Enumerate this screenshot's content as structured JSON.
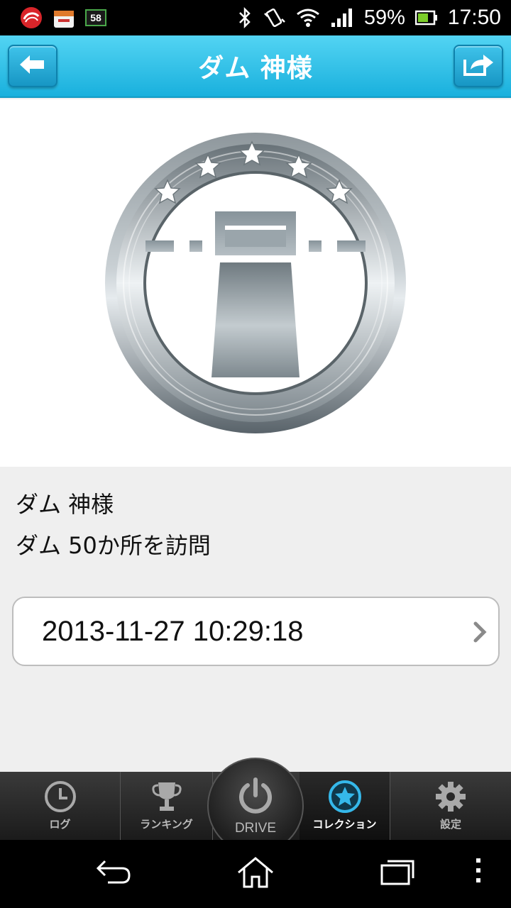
{
  "status_bar": {
    "notification_icons": [
      "trend-micro-icon",
      "market-icon",
      "counter-58-icon"
    ],
    "counter_badge": "58",
    "battery_percent": "59%",
    "time": "17:50"
  },
  "header": {
    "title": "ダム 神様",
    "back_icon": "back-arrow-icon",
    "share_icon": "share-icon"
  },
  "medal": {
    "stars": 5,
    "icon": "dam-medal-icon"
  },
  "info": {
    "title": "ダム 神様",
    "description": "ダム 50か所を訪問"
  },
  "history": {
    "items": [
      {
        "datetime": "2013-11-27 10:29:18"
      }
    ]
  },
  "tabs": [
    {
      "label": "ログ",
      "icon": "clock-icon",
      "active": false
    },
    {
      "label": "ランキング",
      "icon": "trophy-icon",
      "active": false
    },
    {
      "label": "DRIVE",
      "icon": "power-icon",
      "active": false
    },
    {
      "label": "コレクション",
      "icon": "star-circle-icon",
      "active": true
    },
    {
      "label": "設定",
      "icon": "gear-icon",
      "active": false
    }
  ],
  "colors": {
    "header_top": "#53d4f3",
    "header_bottom": "#19b0dd",
    "active_tab_icon": "#35b8ea"
  }
}
